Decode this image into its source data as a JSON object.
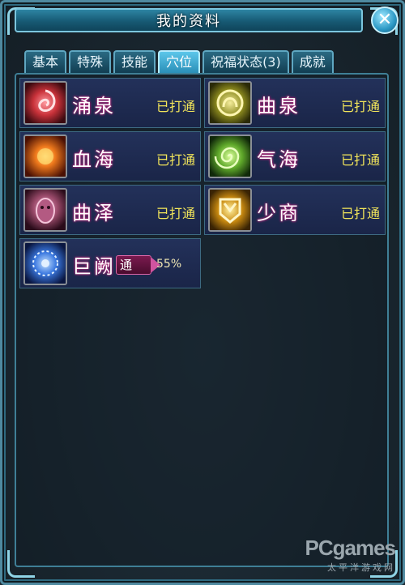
{
  "window": {
    "title": "我的资料",
    "close_label": "✕"
  },
  "tabs": [
    {
      "label": "基本",
      "active": false
    },
    {
      "label": "特殊",
      "active": false
    },
    {
      "label": "技能",
      "active": false
    },
    {
      "label": "穴位",
      "active": true
    },
    {
      "label": "祝福状态(3)",
      "active": false
    },
    {
      "label": "成就",
      "active": false
    }
  ],
  "acupoints": [
    {
      "name": "涌泉",
      "status": "已打通",
      "icon": "yongquan-icon",
      "color": "#c9323a"
    },
    {
      "name": "曲泉",
      "status": "已打通",
      "icon": "ququan-icon",
      "color": "#c6b53a"
    },
    {
      "name": "血海",
      "status": "已打通",
      "icon": "xuehai-icon",
      "color": "#f07a1c"
    },
    {
      "name": "气海",
      "status": "已打通",
      "icon": "qihai-icon",
      "color": "#7fd23a"
    },
    {
      "name": "曲泽",
      "status": "已打通",
      "icon": "quze-icon",
      "color": "#9a4a6a"
    },
    {
      "name": "少商",
      "status": "已打通",
      "icon": "shaoshang-icon",
      "color": "#e8a51e"
    },
    {
      "name": "巨阙",
      "status": "",
      "icon": "juque-icon",
      "color": "#3a78e0",
      "action_label": "通",
      "progress": 0.55,
      "progress_label": "55%"
    }
  ],
  "watermark": {
    "main": "PCgames",
    "sub": "太平洋游戏网"
  }
}
